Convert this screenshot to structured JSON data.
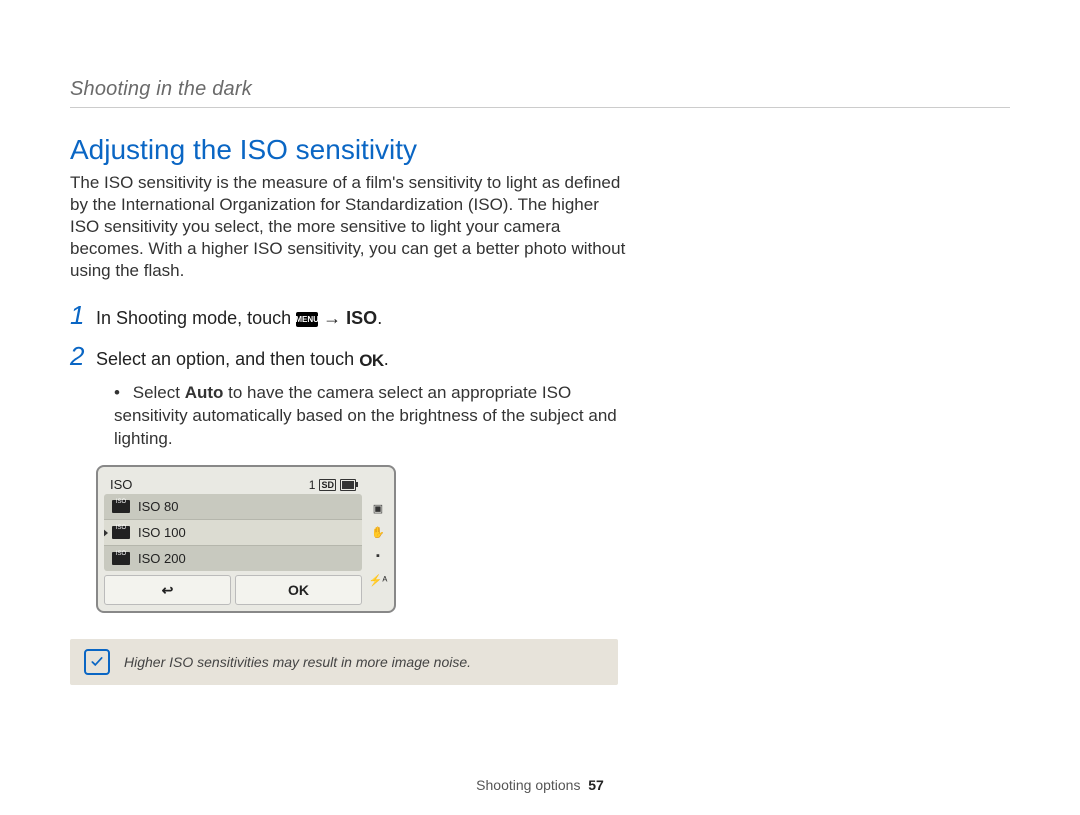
{
  "breadcrumb": "Shooting in the dark",
  "heading": "Adjusting the ISO sensitivity",
  "intro": "The ISO sensitivity is the measure of a film's sensitivity to light as defined by the International Organization for Standardization (ISO). The higher ISO sensitivity you select, the more sensitive to light your camera becomes. With a higher ISO sensitivity, you can get a better photo without using the flash.",
  "steps": {
    "step1_prefix": "In Shooting mode, touch ",
    "step1_menu": "MENU",
    "step1_arrow": " → ",
    "step1_target": "ISO",
    "step1_period": ".",
    "step2_prefix": "Select an option, and then touch ",
    "step2_ok": "OK",
    "step2_period": "."
  },
  "subbullet": {
    "lead": "Select ",
    "bold": "Auto",
    "rest": " to have the camera select an appropriate ISO sensitivity automatically based on the brightness of the subject and lighting."
  },
  "device": {
    "title": "ISO",
    "shots": "1",
    "items": [
      "ISO 80",
      "ISO 100",
      "ISO 200"
    ],
    "selected_index": 1,
    "back_symbol": "↩",
    "ok_label": "OK",
    "side_labels": [
      "▣",
      "✋",
      "▪",
      "⚡ᴬ"
    ]
  },
  "note": "Higher ISO sensitivities may result in more image noise.",
  "footer_section": "Shooting options",
  "footer_page": "57"
}
